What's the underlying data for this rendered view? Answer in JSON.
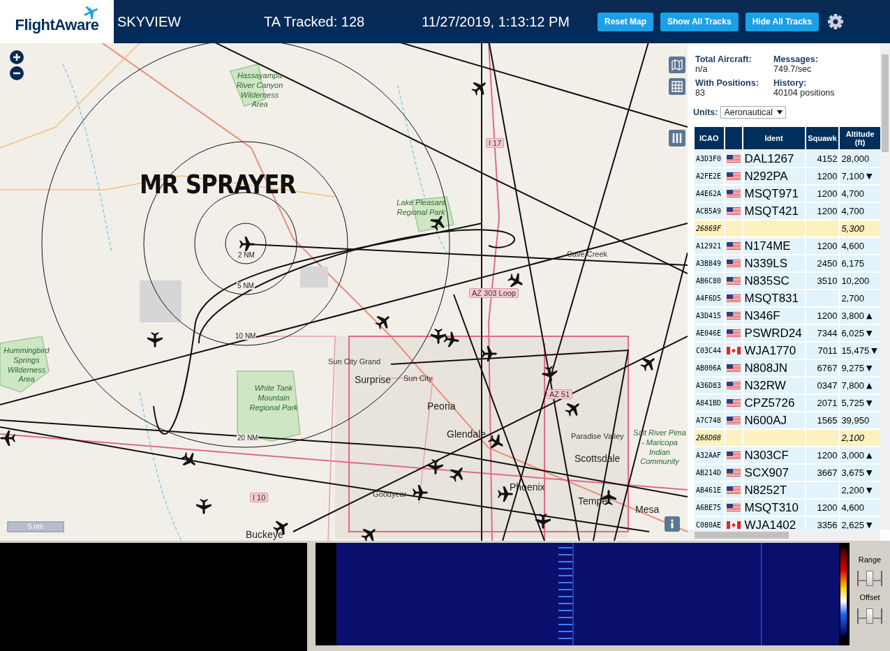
{
  "header": {
    "logo": "FlightAware",
    "title": "SKYVIEW",
    "tracked": "TA Tracked: 128",
    "datetime": "11/27/2019, 1:13:12 PM",
    "buttons": [
      "Reset Map",
      "Show All Tracks",
      "Hide All Tracks"
    ]
  },
  "map": {
    "overlay_title": "MR SPRAYER",
    "ring_labels": [
      "2 NM",
      "5 NM",
      "10 NM",
      "20 NM"
    ],
    "labels": [
      {
        "kind": "park",
        "text": "Hassayampa River Canyon Wilderness Area"
      },
      {
        "kind": "park",
        "text": "Lake Pleasant Regional Park"
      },
      {
        "kind": "highway",
        "text": "I 17"
      },
      {
        "kind": "town",
        "text": "Cave Creek"
      },
      {
        "kind": "highway",
        "text": "AZ 303 Loop"
      },
      {
        "kind": "park",
        "text": "Hummingbird Springs Wilderness Area"
      },
      {
        "kind": "town",
        "text": "Sun City Grand"
      },
      {
        "kind": "city",
        "text": "Surprise"
      },
      {
        "kind": "town",
        "text": "Sun City"
      },
      {
        "kind": "park",
        "text": "White Tank Mountain Regional Park"
      },
      {
        "kind": "city",
        "text": "Peoria"
      },
      {
        "kind": "highway",
        "text": "AZ 51"
      },
      {
        "kind": "city",
        "text": "Glendale"
      },
      {
        "kind": "town",
        "text": "Paradise Valley"
      },
      {
        "kind": "city",
        "text": "Scottsdale"
      },
      {
        "kind": "park",
        "text": "Salt River Pima - Maricopa Indian Community"
      },
      {
        "kind": "highway",
        "text": "I 10"
      },
      {
        "kind": "town",
        "text": "Goodyear"
      },
      {
        "kind": "city",
        "text": "Phoenix"
      },
      {
        "kind": "city",
        "text": "Tempe"
      },
      {
        "kind": "city",
        "text": "Mesa"
      },
      {
        "kind": "city",
        "text": "Buckeye"
      }
    ],
    "scale": "5 nm"
  },
  "stats": [
    {
      "label": "Total Aircraft:",
      "value": "n/a"
    },
    {
      "label": "Messages:",
      "value": "749.7/sec"
    },
    {
      "label": "With Positions:",
      "value": "83"
    },
    {
      "label": "History:",
      "value": "40104 positions"
    }
  ],
  "units": {
    "label": "Units:",
    "value": "Aeronautical"
  },
  "table": {
    "columns": [
      "ICAO",
      "Ident",
      "Squawk",
      "Altitude (ft)"
    ],
    "rows": [
      {
        "kind": "us",
        "icao": "A3D3F0",
        "ident": "DAL1267",
        "squawk": "4152",
        "altitude": "28,000",
        "no_position": false
      },
      {
        "kind": "us",
        "icao": "A2FE2E",
        "ident": "N292PA",
        "squawk": "1200",
        "altitude": "7,100",
        "trend": "▼",
        "no_position": false
      },
      {
        "kind": "us",
        "icao": "A4E62A",
        "ident": "MSQT971",
        "squawk": "1200",
        "altitude": "4,700",
        "no_position": false
      },
      {
        "kind": "us",
        "icao": "ACB5A9",
        "ident": "MSQT421",
        "squawk": "1200",
        "altitude": "4,700",
        "no_position": false
      },
      {
        "kind": "unknown",
        "icao": "26869F",
        "altitude": "5,300",
        "no_position": true
      },
      {
        "kind": "us",
        "icao": "A12921",
        "ident": "N174ME",
        "squawk": "1200",
        "altitude": "4,600",
        "no_position": false
      },
      {
        "kind": "us",
        "icao": "A3B849",
        "ident": "N339LS",
        "squawk": "2450",
        "altitude": "6,175",
        "no_position": false
      },
      {
        "kind": "us",
        "icao": "AB6C80",
        "ident": "N835SC",
        "squawk": "3510",
        "altitude": "10,200",
        "no_position": false
      },
      {
        "kind": "us",
        "icao": "A4F6D5",
        "ident": "MSQT831",
        "altitude": "2,700",
        "no_position": false
      },
      {
        "kind": "us",
        "icao": "A3D415",
        "ident": "N346F",
        "squawk": "1200",
        "altitude": "3,800",
        "trend": "▲",
        "no_position": false
      },
      {
        "kind": "us",
        "icao": "AE046E",
        "ident": "PSWRD24",
        "squawk": "7344",
        "altitude": "6,025",
        "trend": "▼",
        "no_position": false
      },
      {
        "kind": "ca",
        "icao": "C03C44",
        "ident": "WJA1770",
        "squawk": "7011",
        "altitude": "15,475",
        "trend": "▼",
        "no_position": false
      },
      {
        "kind": "us",
        "icao": "AB006A",
        "ident": "N808JN",
        "squawk": "6767",
        "altitude": "9,275",
        "trend": "▼",
        "no_position": false
      },
      {
        "kind": "us",
        "icao": "A36D83",
        "ident": "N32RW",
        "squawk": "0347",
        "altitude": "7,800",
        "trend": "▲",
        "no_position": false
      },
      {
        "kind": "us",
        "icao": "A841BD",
        "ident": "CPZ5726",
        "squawk": "2071",
        "altitude": "5,725",
        "trend": "▼",
        "no_position": false
      },
      {
        "kind": "us",
        "icao": "A7C748",
        "ident": "N600AJ",
        "squawk": "1565",
        "altitude": "39,950",
        "no_position": false
      },
      {
        "kind": "unknown",
        "icao": "268D08",
        "altitude": "2,100",
        "no_position": true
      },
      {
        "kind": "us",
        "icao": "A32AAF",
        "ident": "N303CF",
        "squawk": "1200",
        "altitude": "3,000",
        "trend": "▲",
        "no_position": false
      },
      {
        "kind": "us",
        "icao": "AB214D",
        "ident": "SCX907",
        "squawk": "3667",
        "altitude": "3,675",
        "trend": "▼",
        "no_position": false
      },
      {
        "kind": "us",
        "icao": "AB461E",
        "ident": "N8252T",
        "altitude": "2,200",
        "trend": "▼",
        "no_position": false
      },
      {
        "kind": "us",
        "icao": "A6BE75",
        "ident": "MSQT310",
        "squawk": "1200",
        "altitude": "4,600",
        "no_position": false
      },
      {
        "kind": "ca",
        "icao": "C080AE",
        "ident": "WJA1402",
        "squawk": "3356",
        "altitude": "2,625",
        "trend": "▼",
        "no_position": false
      }
    ]
  },
  "spectrum": {
    "sliders": [
      {
        "label": "Range",
        "level": 0.5
      },
      {
        "label": "Offset",
        "level": 0.5
      }
    ]
  }
}
